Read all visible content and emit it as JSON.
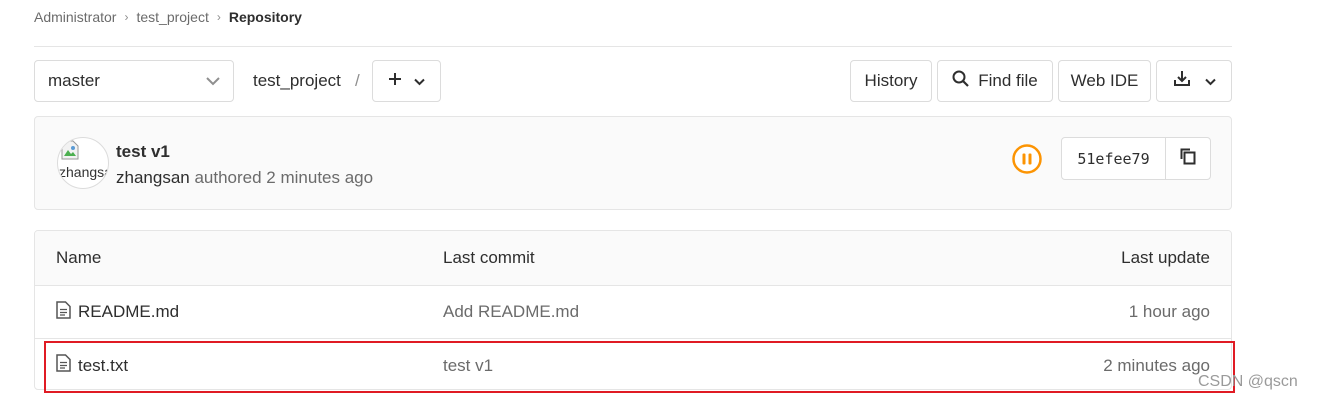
{
  "breadcrumb": {
    "items": [
      "Administrator",
      "test_project"
    ],
    "current": "Repository"
  },
  "toolbar": {
    "branch": "master",
    "path_root": "test_project",
    "path_sep": "/",
    "history": "History",
    "find_file": "Find file",
    "web_ide": "Web IDE"
  },
  "commit": {
    "title": "test v1",
    "avatar_alt": "zhangsan",
    "author": "zhangsan",
    "meta": "authored 2 minutes ago",
    "sha": "51efee79",
    "status_color": "#fc9403"
  },
  "table": {
    "headers": {
      "name": "Name",
      "last_commit": "Last commit",
      "last_update": "Last update"
    },
    "rows": [
      {
        "name": "README.md",
        "last_commit": "Add README.md",
        "last_update": "1 hour ago"
      },
      {
        "name": "test.txt",
        "last_commit": "test v1",
        "last_update": "2 minutes ago"
      }
    ]
  },
  "highlight_color": "#e01b24",
  "watermark": "CSDN @qscn"
}
